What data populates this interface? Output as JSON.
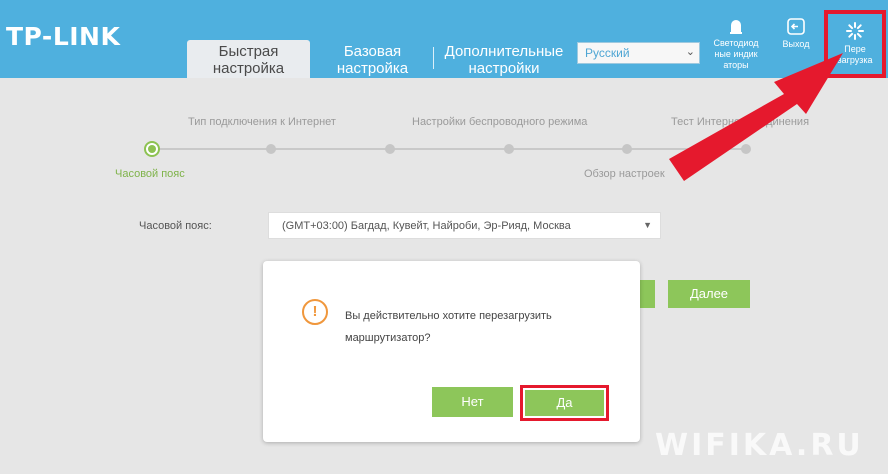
{
  "header": {
    "logo": "TP-LINK",
    "tabs": [
      {
        "line1": "Быстрая",
        "line2": "настройка",
        "active": true
      },
      {
        "line1": "Базовая",
        "line2": "настройка",
        "active": false
      },
      {
        "line1": "Дополнительные",
        "line2": "настройки",
        "active": false
      }
    ],
    "language": "Русский",
    "buttons": {
      "led": {
        "line1": "Светодиод",
        "line2": "ные индик",
        "line3": "аторы",
        "icon": "led-icon"
      },
      "logout": {
        "label": "Выход",
        "icon": "logout-icon"
      },
      "reboot": {
        "line1": "Пере",
        "line2": "загрузка",
        "icon": "reboot-icon"
      }
    }
  },
  "stepper": {
    "top_labels": [
      "Тип подключения к Интернет",
      "Настройки беспроводного режима",
      "Тест Интернет-соединения"
    ],
    "bottom_labels": [
      "Часовой пояс",
      "Обзор настроек"
    ],
    "active_step": 1,
    "steps_total": 6
  },
  "form": {
    "timezone_label": "Часовой пояс:",
    "timezone_value": "(GMT+03:00) Багдад, Кувейт, Найроби, Эр-Рияд, Москва",
    "next_label": "Далее"
  },
  "dialog": {
    "message_line1": "Вы действительно хотите перезагрузить",
    "message_line2": "маршрутизатор?",
    "no_label": "Нет",
    "yes_label": "Да"
  },
  "watermark": "WIFIKA.RU",
  "colors": {
    "header": "#4fb0de",
    "accent_green": "#8dc65a",
    "highlight_red": "#e5192d",
    "warning_orange": "#f0973c"
  }
}
